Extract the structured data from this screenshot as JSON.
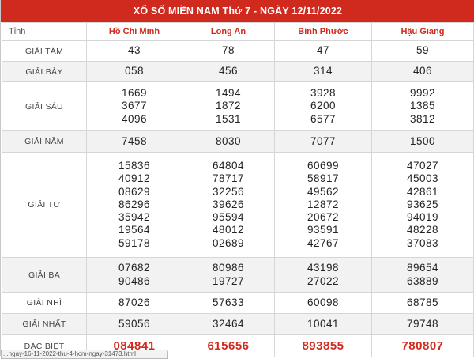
{
  "title": "XỔ SỐ MIỀN NAM Thứ 7 - NGÀY 12/11/2022",
  "header": {
    "label": "Tỉnh",
    "provinces": [
      "Hồ Chí Minh",
      "Long An",
      "Bình Phước",
      "Hậu Giang"
    ]
  },
  "prizes": {
    "g8": {
      "label": "GIẢI TÁM",
      "values": [
        [
          "43"
        ],
        [
          "78"
        ],
        [
          "47"
        ],
        [
          "59"
        ]
      ]
    },
    "g7": {
      "label": "GIẢI BẢY",
      "values": [
        [
          "058"
        ],
        [
          "456"
        ],
        [
          "314"
        ],
        [
          "406"
        ]
      ]
    },
    "g6": {
      "label": "GIẢI SÁU",
      "values": [
        [
          "1669",
          "3677",
          "4096"
        ],
        [
          "1494",
          "1872",
          "1531"
        ],
        [
          "3928",
          "6200",
          "6577"
        ],
        [
          "9992",
          "1385",
          "3812"
        ]
      ]
    },
    "g5": {
      "label": "GIẢI NĂM",
      "values": [
        [
          "7458"
        ],
        [
          "8030"
        ],
        [
          "7077"
        ],
        [
          "1500"
        ]
      ]
    },
    "g4": {
      "label": "GIẢI TƯ",
      "values": [
        [
          "15836",
          "40912",
          "08629",
          "86296",
          "35942",
          "19564",
          "59178"
        ],
        [
          "64804",
          "78717",
          "32256",
          "39626",
          "95594",
          "48012",
          "02689"
        ],
        [
          "60699",
          "58917",
          "49562",
          "12872",
          "20672",
          "93591",
          "42767"
        ],
        [
          "47027",
          "45003",
          "42861",
          "93625",
          "94019",
          "48228",
          "37083"
        ]
      ]
    },
    "g3": {
      "label": "GIẢI BA",
      "values": [
        [
          "07682",
          "90486"
        ],
        [
          "80986",
          "19727"
        ],
        [
          "43198",
          "27022"
        ],
        [
          "89654",
          "63889"
        ]
      ]
    },
    "g2": {
      "label": "GIẢI NHÌ",
      "values": [
        [
          "87026"
        ],
        [
          "57633"
        ],
        [
          "60098"
        ],
        [
          "68785"
        ]
      ]
    },
    "g1": {
      "label": "GIẢI NHẤT",
      "values": [
        [
          "59056"
        ],
        [
          "32464"
        ],
        [
          "10041"
        ],
        [
          "79748"
        ]
      ]
    },
    "db": {
      "label": "ĐẶC BIỆT",
      "values": [
        [
          "084841"
        ],
        [
          "615656"
        ],
        [
          "893855"
        ],
        [
          "780807"
        ]
      ]
    }
  },
  "status_url": "...ngay-16-11-2022-thu-4-hcm-ngay-31473.html",
  "colors": {
    "accent": "#d02a1f",
    "alt_row": "#f2f2f2"
  }
}
